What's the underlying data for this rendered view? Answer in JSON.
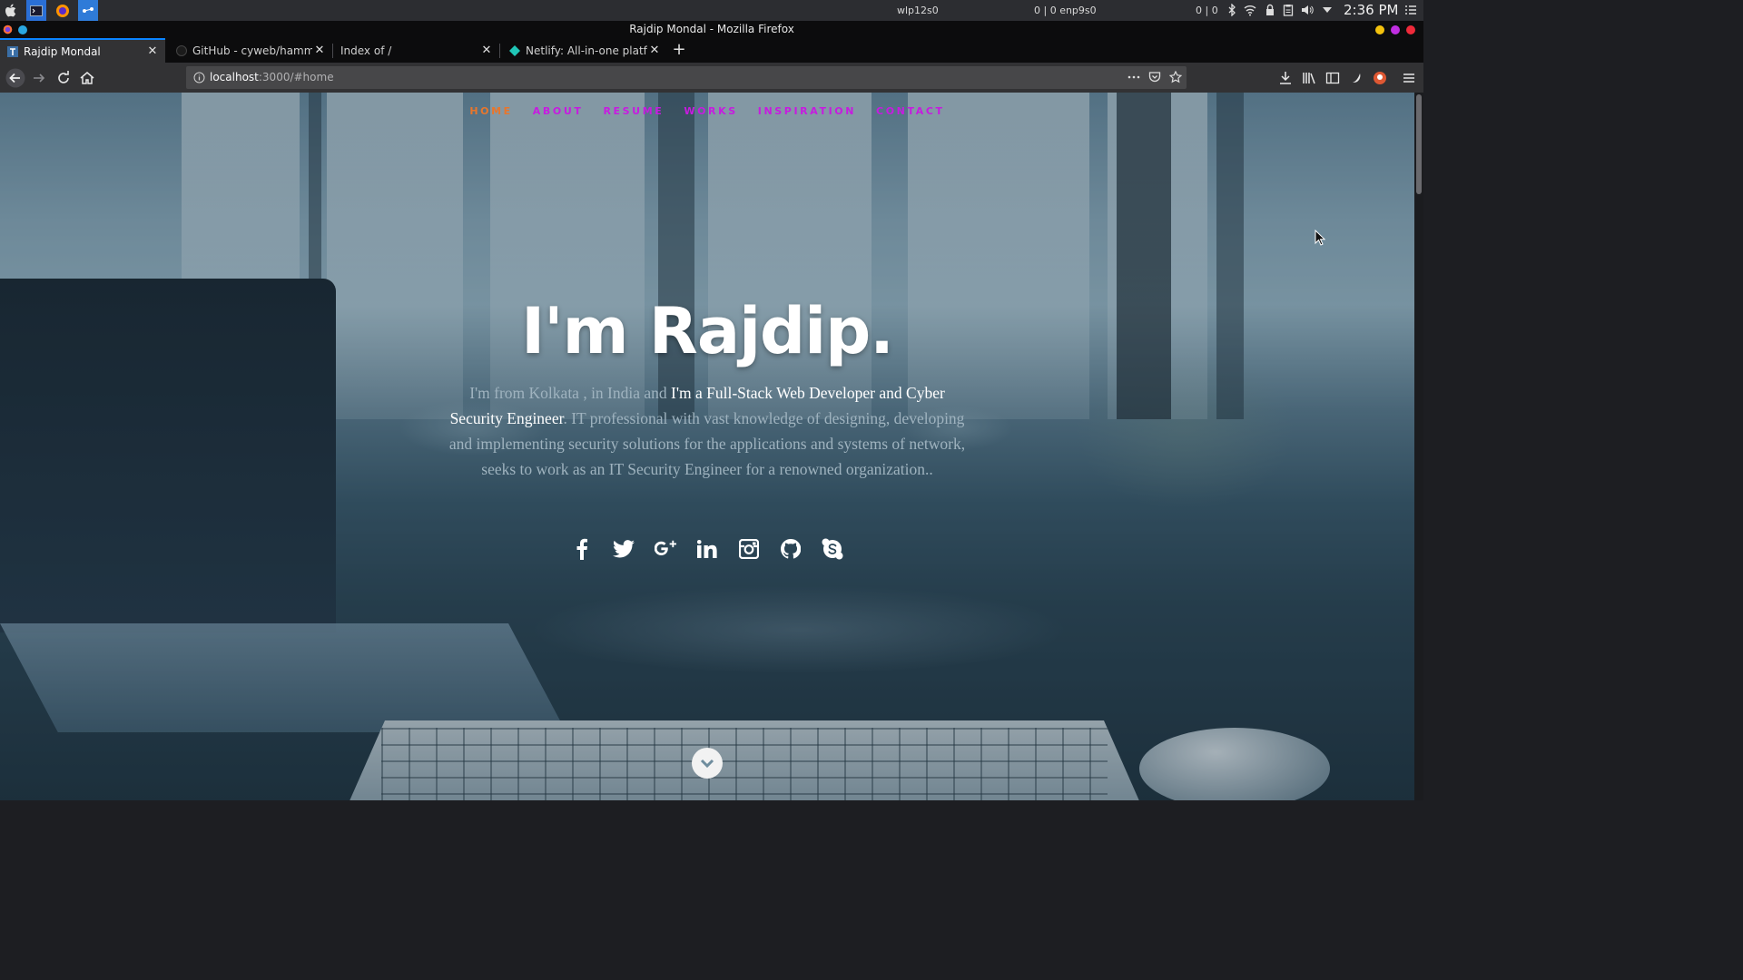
{
  "system_panel": {
    "network_wifi": "wlp12s0",
    "network_eth": "0 | 0 enp9s0",
    "traffic": "0 | 0",
    "clock": "2:36 PM"
  },
  "window": {
    "title": "Rajdip Mondal - Mozilla Firefox"
  },
  "tabs": [
    {
      "label": "Rajdip Mondal",
      "active": true
    },
    {
      "label": "GitHub - cyweb/hammer: H",
      "active": false
    },
    {
      "label": "Index of /",
      "active": false
    },
    {
      "label": "Netlify: All-in-one platform",
      "active": false
    }
  ],
  "urlbar": {
    "host": "localhost",
    "path": ":3000/#home"
  },
  "site": {
    "nav": [
      "HOME",
      "ABOUT",
      "RESUME",
      "WORKS",
      "INSPIRATION",
      "CONTACT"
    ],
    "title": "I'm Rajdip.",
    "desc_part1": "I'm from Kolkata , in India and ",
    "desc_highlight": "I'm a Full-Stack Web Developer and Cyber Security Engineer",
    "desc_part2": ". IT professional with vast knowledge of designing, developing and implementing security solutions for the applications and systems of network, seeks to work as an IT Security Engineer for a renowned organization..",
    "socials": [
      "facebook-icon",
      "twitter-icon",
      "google-plus-icon",
      "linkedin-icon",
      "instagram-icon",
      "github-icon",
      "skype-icon"
    ]
  },
  "colors": {
    "nav_link": "#c71be0",
    "nav_current": "#e8762c",
    "tab_accent": "#0a84ff"
  }
}
